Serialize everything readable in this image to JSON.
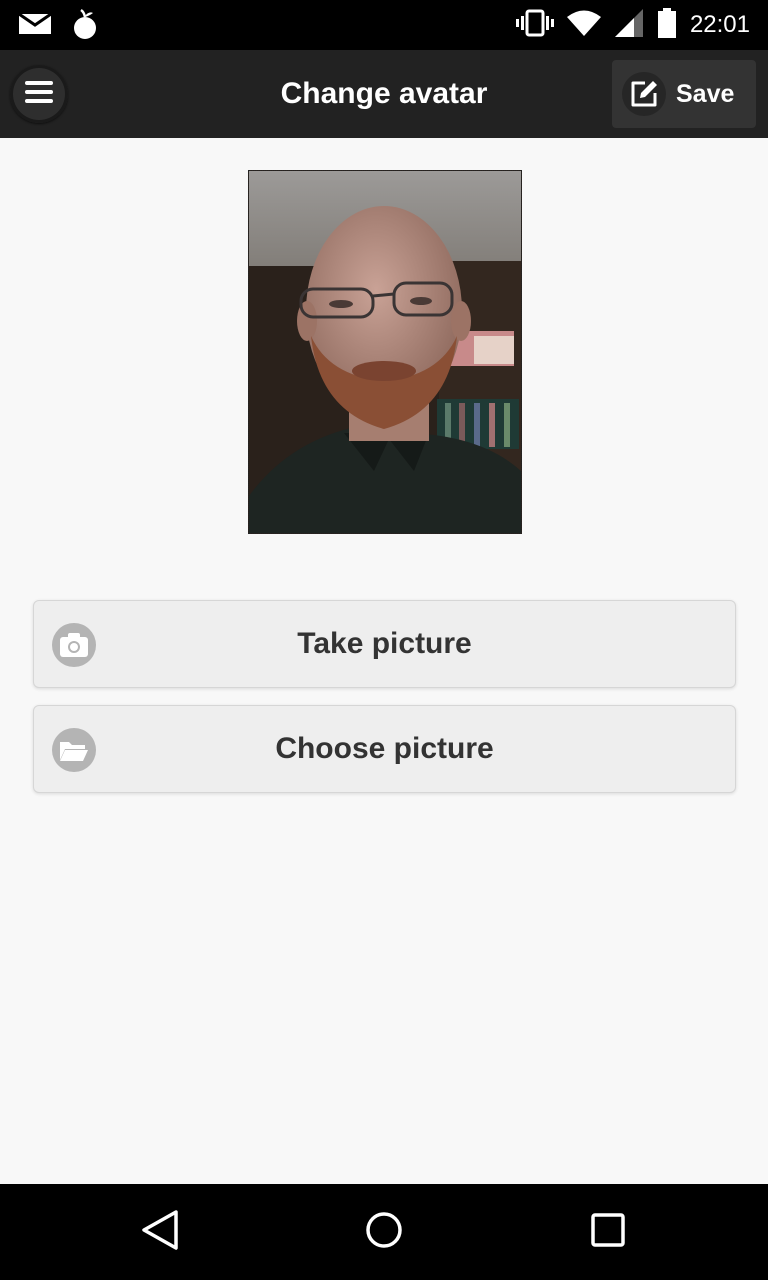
{
  "status_bar": {
    "time": "22:01",
    "icons": [
      "mail-icon",
      "app-notification-icon",
      "vibrate-icon",
      "wifi-icon",
      "signal-icon",
      "battery-icon"
    ]
  },
  "header": {
    "title": "Change avatar",
    "menu_icon": "hamburger-menu-icon",
    "save_label": "Save",
    "save_icon": "edit-icon",
    "background_color": "#222222"
  },
  "avatar": {
    "description_icon": "user-photo"
  },
  "actions": [
    {
      "label": "Take picture",
      "icon": "camera-icon"
    },
    {
      "label": "Choose picture",
      "icon": "folder-open-icon"
    }
  ],
  "navigation": {
    "icons": [
      "back-icon",
      "home-icon",
      "recents-icon"
    ]
  },
  "colors": {
    "background": "#f8f8f8",
    "button_bg": "#eeeeee",
    "button_text": "#333333",
    "icon_circle": "#b4b4b4"
  }
}
